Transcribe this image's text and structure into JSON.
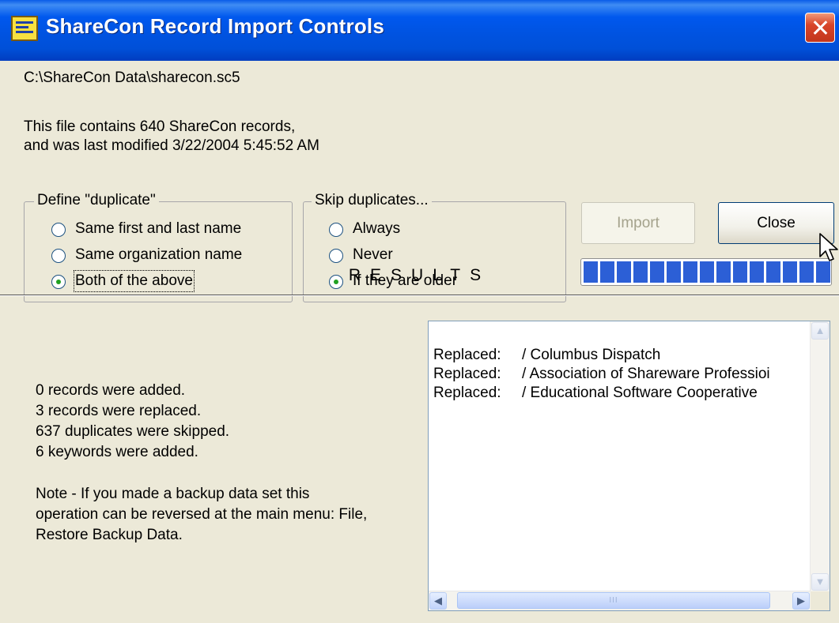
{
  "window": {
    "title": "ShareCon Record Import Controls"
  },
  "file": {
    "path": "C:\\ShareCon Data\\sharecon.sc5",
    "info_line1": "This file contains 640 ShareCon records,",
    "info_line2": "and was last modified 3/22/2004 5:45:52 AM"
  },
  "define_duplicate": {
    "legend": "Define \"duplicate\"",
    "options": [
      "Same first and last name",
      "Same organization name",
      "Both of the above"
    ],
    "selected": "Both of the above"
  },
  "skip_duplicates": {
    "legend": "Skip duplicates...",
    "options": [
      "Always",
      "Never",
      "If they are older"
    ],
    "selected": "If they are older"
  },
  "buttons": {
    "import": "Import",
    "close": "Close"
  },
  "progress": {
    "value": 1.0,
    "color": "#2c5fd6"
  },
  "results": {
    "title": "RESULTS",
    "summary": [
      "0 records were added.",
      "3 records were replaced.",
      "637 duplicates were skipped.",
      "6 keywords were added."
    ],
    "note_lines": [
      "Note - If you made a backup data set this",
      "operation can be reversed at the main menu: File,",
      "Restore Backup Data."
    ],
    "log": [
      {
        "action": "Replaced:",
        "name": "/ Columbus Dispatch"
      },
      {
        "action": "Replaced:",
        "name": "/ Association of Shareware Professioi"
      },
      {
        "action": "Replaced:",
        "name": "/ Educational Software Cooperative"
      }
    ],
    "hscroll_thumb_grip": "III"
  },
  "colors": {
    "titlebar": "#0054e3",
    "window_bg": "#ece9d8",
    "close_button": "#d8452a"
  }
}
